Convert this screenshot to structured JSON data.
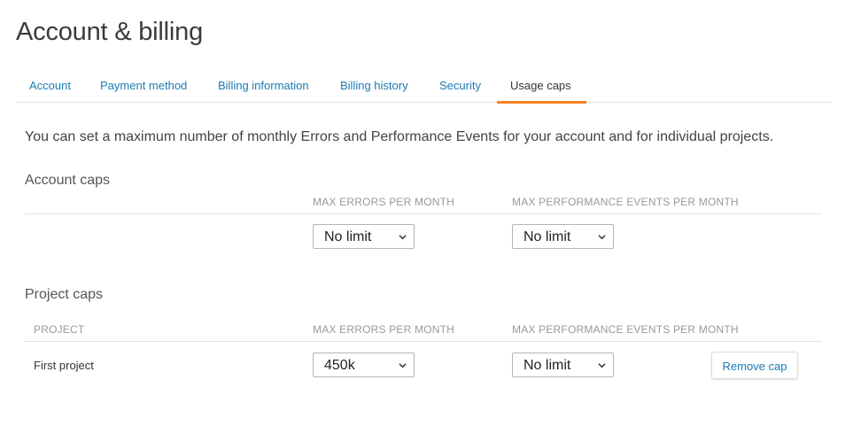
{
  "page": {
    "title": "Account & billing"
  },
  "tabs": [
    {
      "label": "Account"
    },
    {
      "label": "Payment method"
    },
    {
      "label": "Billing information"
    },
    {
      "label": "Billing history"
    },
    {
      "label": "Security"
    },
    {
      "label": "Usage caps",
      "active": true
    }
  ],
  "intro": "You can set a maximum number of monthly Errors and Performance Events for your account and for individual projects.",
  "account_caps": {
    "title": "Account caps",
    "columns": {
      "errors": "MAX ERRORS PER MONTH",
      "performance": "MAX PERFORMANCE EVENTS PER MONTH"
    },
    "errors_value": "No limit",
    "performance_value": "No limit"
  },
  "project_caps": {
    "title": "Project caps",
    "columns": {
      "project": "PROJECT",
      "errors": "MAX ERRORS PER MONTH",
      "performance": "MAX PERFORMANCE EVENTS PER MONTH"
    },
    "rows": [
      {
        "project": "First project",
        "errors_value": "450k",
        "performance_value": "No limit",
        "action": "Remove cap"
      }
    ]
  },
  "colors": {
    "link": "#1b7bb2",
    "active_tab_underline": "#f58220"
  },
  "icons": {
    "select_arrow": "chevron-down-icon"
  }
}
